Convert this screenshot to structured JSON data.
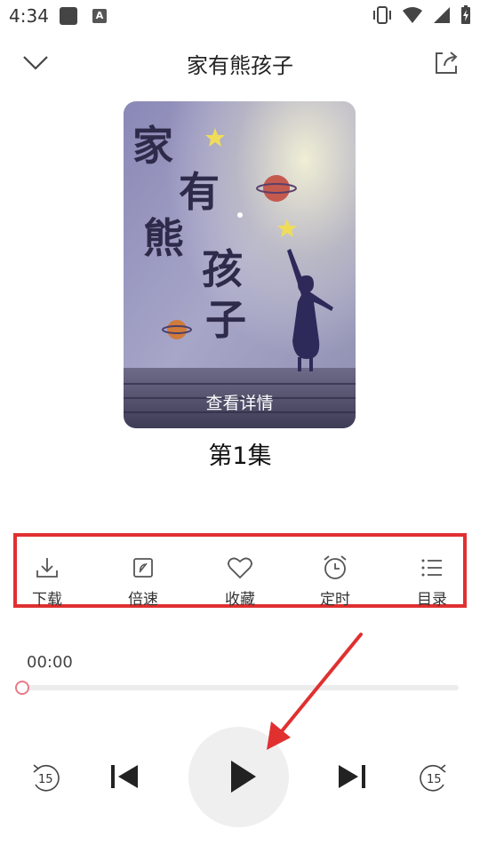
{
  "status_bar": {
    "time": "4:34",
    "a_badge": "A"
  },
  "header": {
    "title": "家有熊孩子",
    "back_icon": "chevron-down-icon",
    "share_icon": "share-icon"
  },
  "cover": {
    "title_chars": [
      "家",
      "有",
      "熊",
      "孩",
      "子"
    ],
    "detail_label": "查看详情"
  },
  "episode": "第1集",
  "actions": [
    {
      "label": "下载",
      "icon": "download-icon"
    },
    {
      "label": "倍速",
      "icon": "speed-icon"
    },
    {
      "label": "收藏",
      "icon": "heart-icon"
    },
    {
      "label": "定时",
      "icon": "alarm-clock-icon"
    },
    {
      "label": "目录",
      "icon": "list-icon"
    }
  ],
  "player": {
    "current_time": "00:00",
    "progress": 0,
    "rewind_seconds": "15",
    "forward_seconds": "15"
  },
  "annotation": {
    "highlight_color": "#e03030",
    "arrow_color": "#e03030"
  }
}
